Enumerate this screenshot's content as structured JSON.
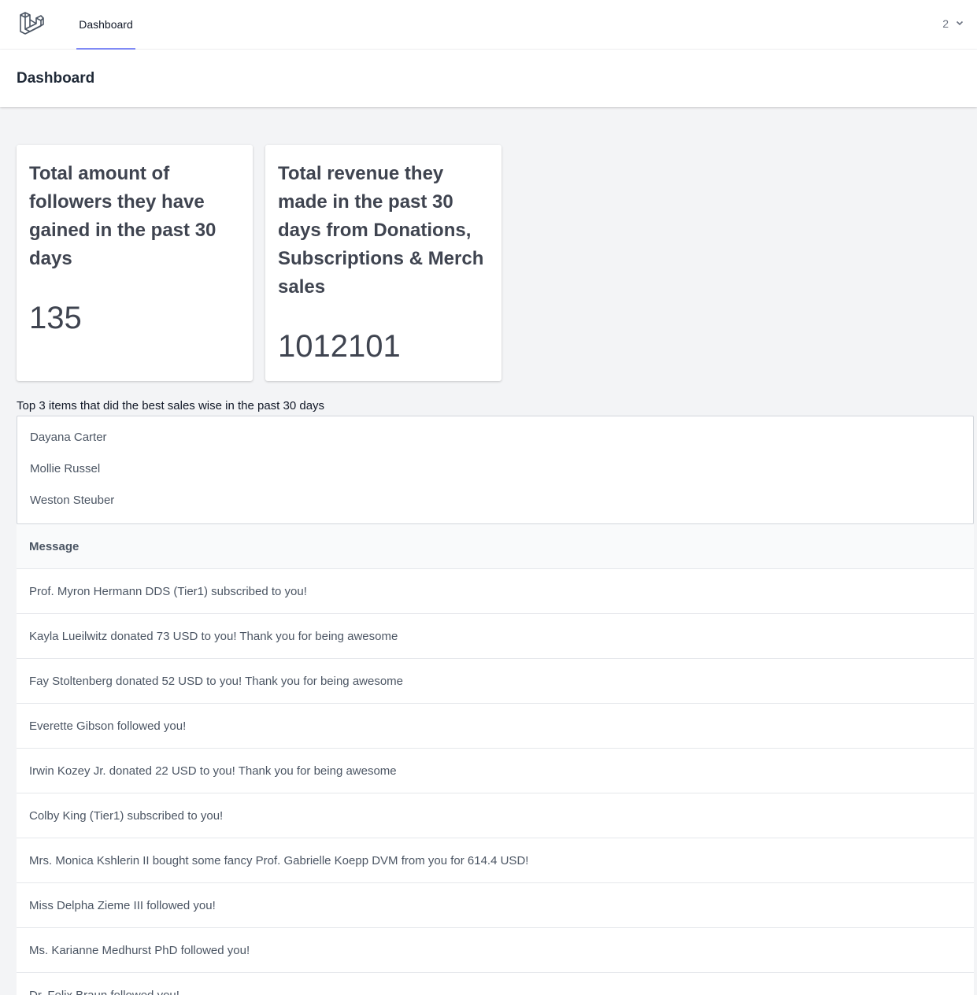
{
  "nav": {
    "dashboard_link": "Dashboard",
    "user_label": "2",
    "accent_color": "#818cf8"
  },
  "header": {
    "title": "Dashboard"
  },
  "cards": [
    {
      "title": "Total amount of followers they have gained in the past 30 days",
      "value": "135"
    },
    {
      "title": "Total revenue they made in the past 30 days from Donations, Subscriptions & Merch sales",
      "value": "1012101"
    }
  ],
  "top_items": {
    "label": "Top 3 items that did the best sales wise in the past 30 days",
    "items": [
      "Dayana Carter",
      "Mollie Russel",
      "Weston Steuber"
    ]
  },
  "messages": {
    "header": "Message",
    "rows": [
      "Prof. Myron Hermann DDS (Tier1) subscribed to you!",
      "Kayla Lueilwitz donated 73 USD to you! Thank you for being awesome",
      "Fay Stoltenberg donated 52 USD to you! Thank you for being awesome",
      "Everette Gibson followed you!",
      "Irwin Kozey Jr. donated 22 USD to you! Thank you for being awesome",
      "Colby King (Tier1) subscribed to you!",
      "Mrs. Monica Kshlerin II bought some fancy Prof. Gabrielle Koepp DVM from you for 614.4 USD!",
      "Miss Delpha Zieme III followed you!",
      "Ms. Karianne Medhurst PhD followed you!",
      "Dr. Felix Braun followed you!"
    ]
  }
}
